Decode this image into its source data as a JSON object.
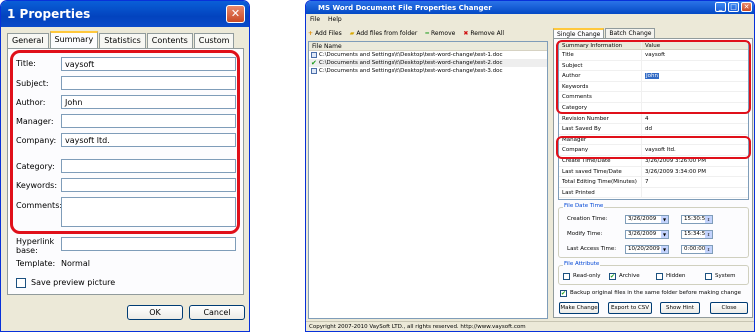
{
  "dialog": {
    "title": "1 Properties",
    "tabs": [
      "General",
      "Summary",
      "Statistics",
      "Contents",
      "Custom"
    ],
    "fields": [
      {
        "label": "Title:",
        "value": "vaysoft"
      },
      {
        "label": "Subject:",
        "value": ""
      },
      {
        "label": "Author:",
        "value": "John"
      },
      {
        "label": "Manager:",
        "value": ""
      },
      {
        "label": "Company:",
        "value": "vaysoft ltd."
      },
      {
        "label": "Category:",
        "value": ""
      },
      {
        "label": "Keywords:",
        "value": ""
      },
      {
        "label": "Comments:",
        "value": ""
      }
    ],
    "hyperlink_label": "Hyperlink base:",
    "template_label": "Template:",
    "template_value": "Normal",
    "save_preview_label": "Save preview picture",
    "ok_label": "OK",
    "cancel_label": "Cancel"
  },
  "app": {
    "title": "MS Word Document File Properties Changer",
    "menu": [
      "File",
      "Help"
    ],
    "toolbar": [
      "Add Files",
      "Add files from folder",
      "Remove",
      "Remove All"
    ],
    "file_list_header": "File Name",
    "files": [
      "C:\\Documents and Settings\\t\\Desktop\\test-word-change\\test-1.doc",
      "C:\\Documents and Settings\\t\\Desktop\\test-word-change\\test-2.doc",
      "C:\\Documents and Settings\\t\\Desktop\\test-word-change\\test-3.doc"
    ],
    "tabs": [
      "Single Change",
      "Batch Change"
    ],
    "grid_headers": [
      "Summary Information",
      "Value"
    ],
    "grid_rows": [
      {
        "key": "Title",
        "value": "vaysoft"
      },
      {
        "key": "Subject",
        "value": ""
      },
      {
        "key": "Author",
        "value": "John"
      },
      {
        "key": "Keywords",
        "value": ""
      },
      {
        "key": "Comments",
        "value": ""
      },
      {
        "key": "Category",
        "value": ""
      },
      {
        "key": "Revision Number",
        "value": "4"
      },
      {
        "key": "Last Saved By",
        "value": "dd"
      },
      {
        "key": "Manager",
        "value": ""
      },
      {
        "key": "Company",
        "value": "vaysoft ltd."
      },
      {
        "key": "Create Time/Date",
        "value": "3/26/2009 3:26:00 PM"
      },
      {
        "key": "Last saved Time/Date",
        "value": "3/26/2009 3:34:00 PM"
      },
      {
        "key": "Total Editing Time(Minutes)",
        "value": "7"
      },
      {
        "key": "Last Printed",
        "value": ""
      }
    ],
    "file_date_time_title": "File Date Time",
    "dates": [
      {
        "label": "Creation Time:",
        "date": "3/26/2009",
        "time": "15:30:59"
      },
      {
        "label": "Modify Time:",
        "date": "3/26/2009",
        "time": "15:34:50"
      },
      {
        "label": "Last Access Time:",
        "date": "10/20/2009",
        "time": "0:00:00"
      }
    ],
    "file_attribute_title": "File Attribute",
    "attributes": [
      {
        "label": "Read-only",
        "checked": false
      },
      {
        "label": "Archive",
        "checked": true
      },
      {
        "label": "Hidden",
        "checked": false
      },
      {
        "label": "System",
        "checked": false
      }
    ],
    "backup_label": "Backup original files in the same folder before making change",
    "buttons": [
      "Make Change",
      "Export to CSV",
      "Show Hint",
      "Close"
    ],
    "status": "Copyright 2007-2010 VaySoft LTD., all rights reserved. http://www.vaysoft.com"
  },
  "colors": {
    "highlight": "#e0101a",
    "titlebar": "#0349c4"
  }
}
